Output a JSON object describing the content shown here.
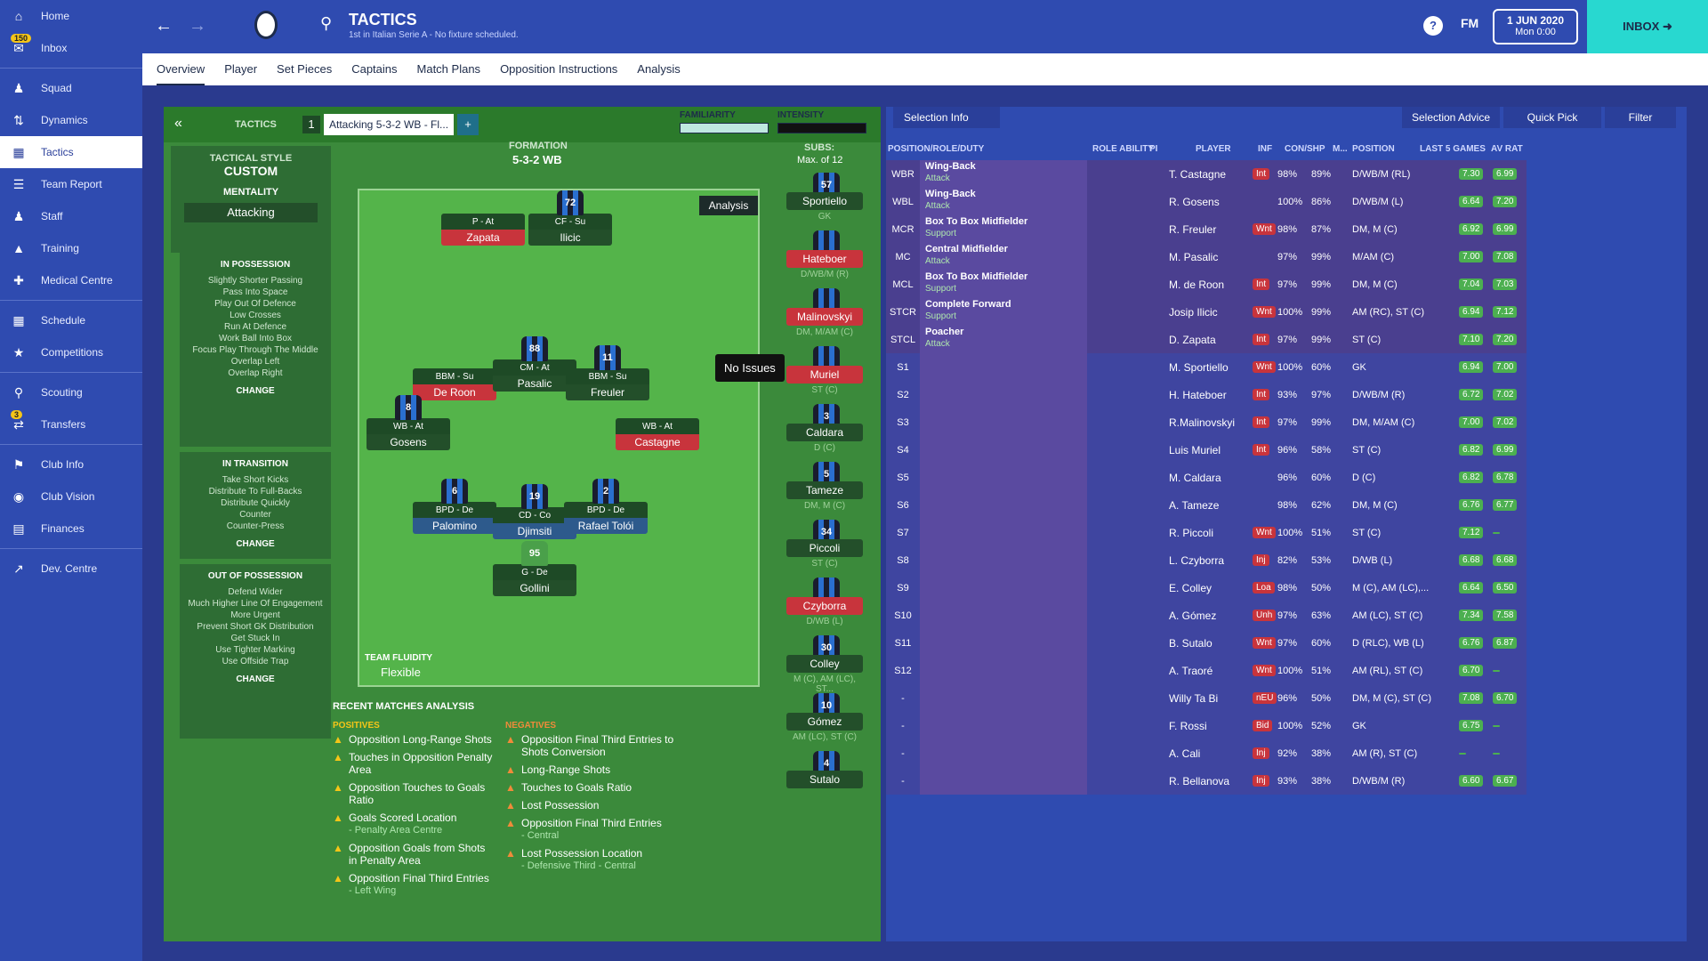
{
  "sidebar": {
    "items": [
      {
        "label": "Home"
      },
      {
        "label": "Inbox",
        "badge": "150"
      },
      {
        "label": "Squad"
      },
      {
        "label": "Dynamics"
      },
      {
        "label": "Tactics"
      },
      {
        "label": "Team Report"
      },
      {
        "label": "Staff"
      },
      {
        "label": "Training"
      },
      {
        "label": "Medical Centre"
      },
      {
        "label": "Schedule"
      },
      {
        "label": "Competitions"
      },
      {
        "label": "Scouting"
      },
      {
        "label": "Transfers",
        "badge": "3"
      },
      {
        "label": "Club Info"
      },
      {
        "label": "Club Vision"
      },
      {
        "label": "Finances"
      },
      {
        "label": "Dev. Centre"
      }
    ]
  },
  "header": {
    "title": "TACTICS",
    "subtitle": "1st in Italian Serie A - No fixture scheduled.",
    "fm": "FM",
    "date": "1 JUN 2020",
    "time": "Mon 0:00",
    "inbox": "INBOX"
  },
  "subnav": [
    "Overview",
    "Player",
    "Set Pieces",
    "Captains",
    "Match Plans",
    "Opposition Instructions",
    "Analysis"
  ],
  "tactics_bar": {
    "tactics_label": "TACTICS",
    "slot": "1",
    "tactic_name": "Attacking 5-3-2 WB - Fl...",
    "familiarity": "FAMILIARITY",
    "intensity": "INTENSITY"
  },
  "tactical_style": {
    "label": "TACTICAL STYLE",
    "value": "CUSTOM",
    "mentality_label": "MENTALITY",
    "mentality": "Attacking"
  },
  "in_possession": {
    "title": "IN POSSESSION",
    "items": [
      "Slightly Shorter Passing",
      "Pass Into Space",
      "Play Out Of Defence",
      "Low Crosses",
      "Run At Defence",
      "Work Ball Into Box",
      "Focus Play Through The Middle",
      "Overlap Left",
      "Overlap Right"
    ],
    "change": "CHANGE"
  },
  "in_transition": {
    "title": "IN TRANSITION",
    "items": [
      "Take Short Kicks",
      "Distribute To Full-Backs",
      "Distribute Quickly",
      "Counter",
      "Counter-Press"
    ],
    "change": "CHANGE"
  },
  "out_possession": {
    "title": "OUT OF POSSESSION",
    "items": [
      "Defend Wider",
      "Much Higher Line Of Engagement",
      "More Urgent",
      "Prevent Short GK Distribution",
      "Get Stuck In",
      "Use Tighter Marking",
      "Use Offside Trap"
    ],
    "change": "CHANGE"
  },
  "formation": {
    "label": "FORMATION",
    "value": "5-3-2 WB",
    "subs_label": "SUBS:",
    "subs_max": "Max. of 12",
    "analysis": "Analysis",
    "fluidity_label": "TEAM FLUIDITY",
    "fluidity": "Flexible",
    "tooltip": "No Issues"
  },
  "pitch_players": [
    {
      "role": "P - At",
      "name": "Zapata",
      "num": "",
      "color": "red"
    },
    {
      "role": "CF - Su",
      "name": "Ilicic",
      "num": "72",
      "color": "dark"
    },
    {
      "role": "BBM - Su",
      "name": "De Roon",
      "num": "",
      "color": "red"
    },
    {
      "role": "CM - At",
      "name": "Pasalic",
      "num": "88",
      "color": "dark"
    },
    {
      "role": "BBM - Su",
      "name": "Freuler",
      "num": "11",
      "color": "dark"
    },
    {
      "role": "WB - At",
      "name": "Gosens",
      "num": "8",
      "color": "dark"
    },
    {
      "role": "WB - At",
      "name": "Castagne",
      "num": "",
      "color": "red"
    },
    {
      "role": "BPD - De",
      "name": "Palomino",
      "num": "6",
      "color": "blue"
    },
    {
      "role": "CD - Co",
      "name": "Djimsiti",
      "num": "19",
      "color": "blue"
    },
    {
      "role": "BPD - De",
      "name": "Rafael Tolói",
      "num": "2",
      "color": "blue"
    },
    {
      "role": "G - De",
      "name": "Gollini",
      "num": "95",
      "color": "dark"
    }
  ],
  "subs": [
    {
      "name": "Sportiello",
      "role": "GK",
      "num": "57",
      "color": "dark"
    },
    {
      "name": "Hateboer",
      "role": "D/WB/M (R)",
      "num": "",
      "color": "red"
    },
    {
      "name": "Malinovskyi",
      "role": "DM, M/AM (C)",
      "num": "",
      "color": "red"
    },
    {
      "name": "Muriel",
      "role": "ST (C)",
      "num": "",
      "color": "red"
    },
    {
      "name": "Caldara",
      "role": "D (C)",
      "num": "3",
      "color": "dark"
    },
    {
      "name": "Tameze",
      "role": "DM, M (C)",
      "num": "5",
      "color": "dark"
    },
    {
      "name": "Piccoli",
      "role": "ST (C)",
      "num": "34",
      "color": "dark"
    },
    {
      "name": "Czyborra",
      "role": "D/WB (L)",
      "num": "",
      "color": "red"
    },
    {
      "name": "Colley",
      "role": "M (C), AM (LC), ST...",
      "num": "30",
      "color": "dark"
    },
    {
      "name": "Gómez",
      "role": "AM (LC), ST (C)",
      "num": "10",
      "color": "dark"
    },
    {
      "name": "Sutalo",
      "role": "",
      "num": "4",
      "color": "dark"
    }
  ],
  "analysis": {
    "title": "RECENT MATCHES ANALYSIS",
    "positives_label": "POSITIVES",
    "negatives_label": "NEGATIVES",
    "positives": [
      {
        "text": "Opposition Long-Range Shots",
        "sub": ""
      },
      {
        "text": "Touches in Opposition Penalty Area",
        "sub": ""
      },
      {
        "text": "Opposition Touches to Goals Ratio",
        "sub": ""
      },
      {
        "text": "Goals Scored Location",
        "sub": "- Penalty Area Centre"
      },
      {
        "text": "Opposition Goals from Shots in Penalty Area",
        "sub": ""
      },
      {
        "text": "Opposition Final Third Entries",
        "sub": "- Left Wing"
      }
    ],
    "negatives": [
      {
        "text": "Opposition Final Third Entries to Shots Conversion",
        "sub": ""
      },
      {
        "text": "Long-Range Shots",
        "sub": ""
      },
      {
        "text": "Touches to Goals Ratio",
        "sub": ""
      },
      {
        "text": "Lost Possession",
        "sub": ""
      },
      {
        "text": "Opposition Final Third Entries",
        "sub": "- Central"
      },
      {
        "text": "Lost Possession Location",
        "sub": "- Defensive Third - Central"
      }
    ]
  },
  "selection": {
    "info": "Selection Info",
    "advice": "Selection Advice",
    "quick_pick": "Quick Pick",
    "filter": "Filter",
    "headers": {
      "pos": "POSITION/ROLE/DUTY",
      "ability": "ROLE ABILITY",
      "pi": "PI",
      "player": "PLAYER",
      "inf": "INF",
      "conshp": "CON/SHP",
      "m": "M...",
      "position": "POSITION",
      "last5": "LAST 5 GAMES",
      "avrat": "AV RAT"
    }
  },
  "rows": [
    {
      "pos": "WBR",
      "role": "Wing-Back",
      "duty": "Attack",
      "player": "T. Castagne",
      "inf": "Int",
      "con": "98%",
      "shp": "89%",
      "position": "D/WB/M (RL)",
      "last": "7.30",
      "av": "6.99"
    },
    {
      "pos": "WBL",
      "role": "Wing-Back",
      "duty": "Attack",
      "player": "R. Gosens",
      "inf": "",
      "con": "100%",
      "shp": "86%",
      "position": "D/WB/M (L)",
      "last": "6.64",
      "av": "7.20"
    },
    {
      "pos": "MCR",
      "role": "Box To Box Midfielder",
      "duty": "Support",
      "player": "R. Freuler",
      "inf": "Wnt",
      "con": "98%",
      "shp": "87%",
      "position": "DM, M (C)",
      "last": "6.92",
      "av": "6.99"
    },
    {
      "pos": "MC",
      "role": "Central Midfielder",
      "duty": "Attack",
      "player": "M. Pasalic",
      "inf": "",
      "con": "97%",
      "shp": "99%",
      "position": "M/AM (C)",
      "last": "7.00",
      "av": "7.08"
    },
    {
      "pos": "MCL",
      "role": "Box To Box Midfielder",
      "duty": "Support",
      "player": "M. de Roon",
      "inf": "Int",
      "con": "97%",
      "shp": "99%",
      "position": "DM, M (C)",
      "last": "7.04",
      "av": "7.03"
    },
    {
      "pos": "STCR",
      "role": "Complete Forward",
      "duty": "Support",
      "player": "Josip Ilicic",
      "inf": "Wnt",
      "con": "100%",
      "shp": "99%",
      "position": "AM (RC), ST (C)",
      "last": "6.94",
      "av": "7.12"
    },
    {
      "pos": "STCL",
      "role": "Poacher",
      "duty": "Attack",
      "player": "D. Zapata",
      "inf": "Int",
      "con": "97%",
      "shp": "99%",
      "position": "ST (C)",
      "last": "7.10",
      "av": "7.20"
    },
    {
      "pos": "S1",
      "role": "",
      "duty": "",
      "player": "M. Sportiello",
      "inf": "Wnt",
      "con": "100%",
      "shp": "60%",
      "position": "GK",
      "last": "6.94",
      "av": "7.00"
    },
    {
      "pos": "S2",
      "role": "",
      "duty": "",
      "player": "H. Hateboer",
      "inf": "Int",
      "con": "93%",
      "shp": "97%",
      "position": "D/WB/M (R)",
      "last": "6.72",
      "av": "7.02"
    },
    {
      "pos": "S3",
      "role": "",
      "duty": "",
      "player": "R.Malinovskyi",
      "inf": "Int",
      "con": "97%",
      "shp": "99%",
      "position": "DM, M/AM (C)",
      "last": "7.00",
      "av": "7.02"
    },
    {
      "pos": "S4",
      "role": "",
      "duty": "",
      "player": "Luis Muriel",
      "inf": "Int",
      "con": "96%",
      "shp": "58%",
      "position": "ST (C)",
      "last": "6.82",
      "av": "6.99"
    },
    {
      "pos": "S5",
      "role": "",
      "duty": "",
      "player": "M. Caldara",
      "inf": "",
      "con": "96%",
      "shp": "60%",
      "position": "D (C)",
      "last": "6.82",
      "av": "6.78"
    },
    {
      "pos": "S6",
      "role": "",
      "duty": "",
      "player": "A. Tameze",
      "inf": "",
      "con": "98%",
      "shp": "62%",
      "position": "DM, M (C)",
      "last": "6.76",
      "av": "6.77"
    },
    {
      "pos": "S7",
      "role": "",
      "duty": "",
      "player": "R. Piccoli",
      "inf": "Wnt",
      "con": "100%",
      "shp": "51%",
      "position": "ST (C)",
      "last": "7.12",
      "av": ""
    },
    {
      "pos": "S8",
      "role": "",
      "duty": "",
      "player": "L. Czyborra",
      "inf": "Inj",
      "con": "82%",
      "shp": "53%",
      "position": "D/WB (L)",
      "last": "6.68",
      "av": "6.68"
    },
    {
      "pos": "S9",
      "role": "",
      "duty": "",
      "player": "E. Colley",
      "inf": "Loa",
      "con": "98%",
      "shp": "50%",
      "position": "M (C), AM (LC),...",
      "last": "6.64",
      "av": "6.50"
    },
    {
      "pos": "S10",
      "role": "",
      "duty": "",
      "player": "A. Gómez",
      "inf": "Unh",
      "con": "97%",
      "shp": "63%",
      "position": "AM (LC), ST (C)",
      "last": "7.34",
      "av": "7.58"
    },
    {
      "pos": "S11",
      "role": "",
      "duty": "",
      "player": "B. Sutalo",
      "inf": "Wnt",
      "con": "97%",
      "shp": "60%",
      "position": "D (RLC), WB (L)",
      "last": "6.76",
      "av": "6.87"
    },
    {
      "pos": "S12",
      "role": "",
      "duty": "",
      "player": "A. Traoré",
      "inf": "Wnt",
      "con": "100%",
      "shp": "51%",
      "position": "AM (RL), ST (C)",
      "last": "6.70",
      "av": ""
    },
    {
      "pos": "-",
      "role": "",
      "duty": "",
      "player": "Willy Ta Bi",
      "inf": "nEU",
      "con": "96%",
      "shp": "50%",
      "position": "DM, M (C), ST (C)",
      "last": "7.08",
      "av": "6.70"
    },
    {
      "pos": "-",
      "role": "",
      "duty": "",
      "player": "F. Rossi",
      "inf": "Bid",
      "con": "100%",
      "shp": "52%",
      "position": "GK",
      "last": "6.75",
      "av": ""
    },
    {
      "pos": "-",
      "role": "",
      "duty": "",
      "player": "A. Cali",
      "inf": "Inj",
      "con": "92%",
      "shp": "38%",
      "position": "AM (R), ST (C)",
      "last": "",
      "av": ""
    },
    {
      "pos": "-",
      "role": "",
      "duty": "",
      "player": "R. Bellanova",
      "inf": "Inj",
      "con": "93%",
      "shp": "38%",
      "position": "D/WB/M (R)",
      "last": "6.60",
      "av": "6.67"
    }
  ]
}
